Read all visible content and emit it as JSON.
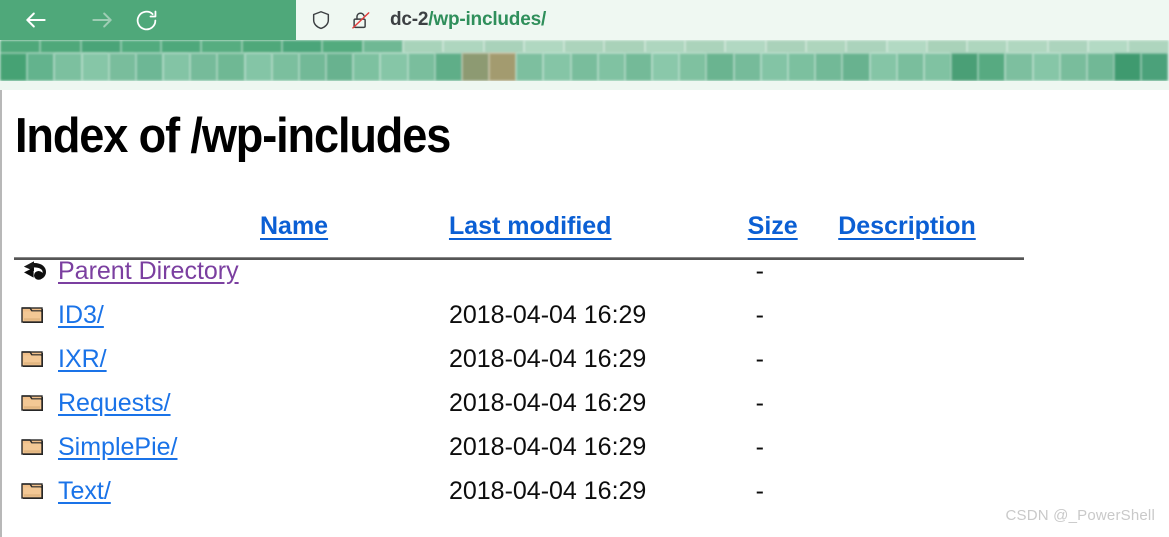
{
  "browser": {
    "nav": {
      "back_label": "Back",
      "forward_label": "Forward",
      "reload_label": "Reload",
      "back_icon": "arrow-left-icon",
      "forward_icon": "arrow-right-icon",
      "reload_icon": "reload-icon"
    },
    "url_bar": {
      "shield_icon": "shield-icon",
      "lock_icon": "broken-lock-icon",
      "host": "dc-2",
      "path": "/wp-includes/",
      "full_url": "dc-2/wp-includes/"
    },
    "colors": {
      "toolbar_green": "#4fa87a",
      "urlbar_bg": "#eff8f2",
      "url_host": "#3c4043",
      "url_path": "#2f8f5b"
    },
    "blurred_band": {
      "description": "pixelated bookmark bar",
      "top_row": [
        "#4fa87a",
        "#4fa87a",
        "#4aa478",
        "#52ab7e",
        "#4ea87b",
        "#56ad80",
        "#4fa87a",
        "#4ba57a",
        "#53ab7e",
        "#6fb894",
        "#a8d3ba",
        "#aed6bf",
        "#a9d2ba",
        "#b0d8c1",
        "#acd4bc",
        "#a9d2b9",
        "#aed6bf",
        "#abd3bb",
        "#b1d8c2",
        "#aad2ba",
        "#aed5bd",
        "#abd3bc",
        "#b2d9c3",
        "#a9d2b9",
        "#aed6be",
        "#b0d7c0",
        "#acd4bd",
        "#b3dac4",
        "#aed5be"
      ],
      "main_row": [
        "#46a274",
        "#63b38d",
        "#7cc09f",
        "#86c6a7",
        "#79bd9c",
        "#6db795",
        "#83c4a5",
        "#76bb9a",
        "#6fb894",
        "#84c5a6",
        "#7bbf9e",
        "#72b997",
        "#68b28f",
        "#7dc1a0",
        "#86c6a7",
        "#7ab e9d",
        "#5fae88",
        "#8d9a72",
        "#a39b6f",
        "#7dbf9f",
        "#85c5a6",
        "#79bd9c",
        "#80c2a2",
        "#74ba98",
        "#8ac8aa",
        "#7fc1a0",
        "#6ab490",
        "#76bb9a",
        "#83c4a5",
        "#7cc09f",
        "#72b997",
        "#68b28f",
        "#85c5a6",
        "#7abe9d",
        "#80c2a2",
        "#4a9f76",
        "#57aa81",
        "#7dbf9f",
        "#86c6a7",
        "#79bd9c",
        "#71b896",
        "#3f9a6f",
        "#4ba17a"
      ]
    }
  },
  "page": {
    "title": "Index of /wp-includes",
    "table": {
      "headers": [
        {
          "label": "Name",
          "key": "name"
        },
        {
          "label": "Last modified",
          "key": "modified"
        },
        {
          "label": "Size",
          "key": "size"
        },
        {
          "label": "Description",
          "key": "description"
        }
      ],
      "rows": [
        {
          "icon": "back-arrow-icon",
          "name": "Parent Directory",
          "modified": "",
          "size": "-",
          "description": "",
          "visited": true
        },
        {
          "icon": "folder-icon",
          "name": "ID3/",
          "modified": "2018-04-04 16:29",
          "size": "-",
          "description": "",
          "visited": false
        },
        {
          "icon": "folder-icon",
          "name": "IXR/",
          "modified": "2018-04-04 16:29",
          "size": "-",
          "description": "",
          "visited": false
        },
        {
          "icon": "folder-icon",
          "name": "Requests/",
          "modified": "2018-04-04 16:29",
          "size": "-",
          "description": "",
          "visited": false
        },
        {
          "icon": "folder-icon",
          "name": "SimplePie/",
          "modified": "2018-04-04 16:29",
          "size": "-",
          "description": "",
          "visited": false
        },
        {
          "icon": "folder-icon",
          "name": "Text/",
          "modified": "2018-04-04 16:29",
          "size": "-",
          "description": "",
          "visited": false
        }
      ]
    },
    "colors": {
      "link": "#1a73e8",
      "link_visited": "#7b3fa0",
      "header_link": "#0b5fd4",
      "rule": "#555555"
    }
  },
  "watermark": {
    "text": "CSDN @_PowerShell"
  }
}
